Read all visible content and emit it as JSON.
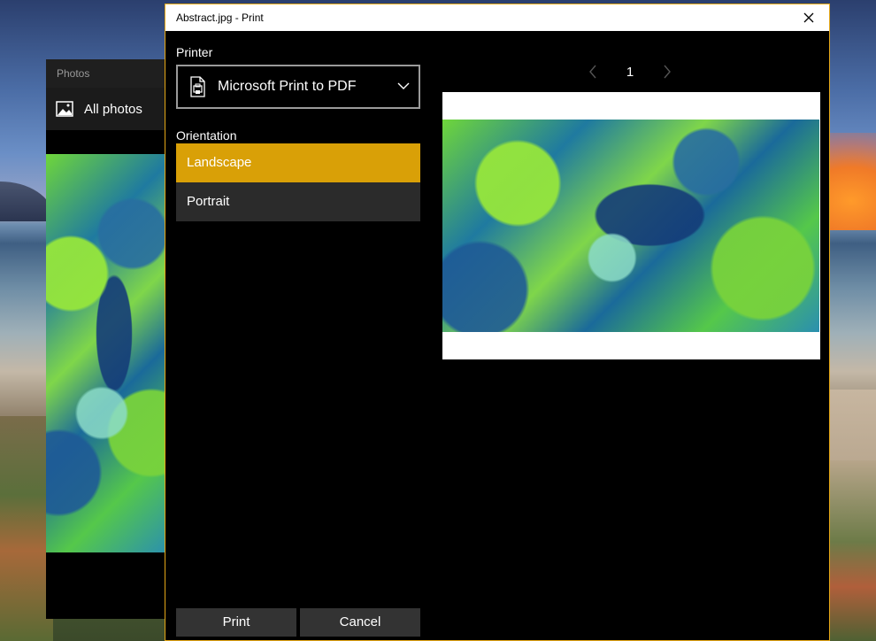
{
  "photos_app": {
    "window_title": "Photos",
    "nav_label": "All photos"
  },
  "print_dialog": {
    "title": "Abstract.jpg - Print",
    "printer_label": "Printer",
    "printer_value": "Microsoft Print to PDF",
    "orientation_label": "Orientation",
    "orientation_options": [
      "Landscape",
      "Portrait"
    ],
    "orientation_selected": "Landscape",
    "page_number": "1",
    "print_button": "Print",
    "cancel_button": "Cancel"
  },
  "icons": {
    "close": "close-icon",
    "dropdown": "chevron-down-icon",
    "printer": "pdf-printer-icon",
    "prev": "chevron-left-icon",
    "next": "chevron-right-icon",
    "photos": "image-icon"
  },
  "colors": {
    "accent": "#d9a007",
    "dialog_border": "#e6a817",
    "button_bg": "#333333",
    "unselected_bg": "#2b2b2b"
  }
}
